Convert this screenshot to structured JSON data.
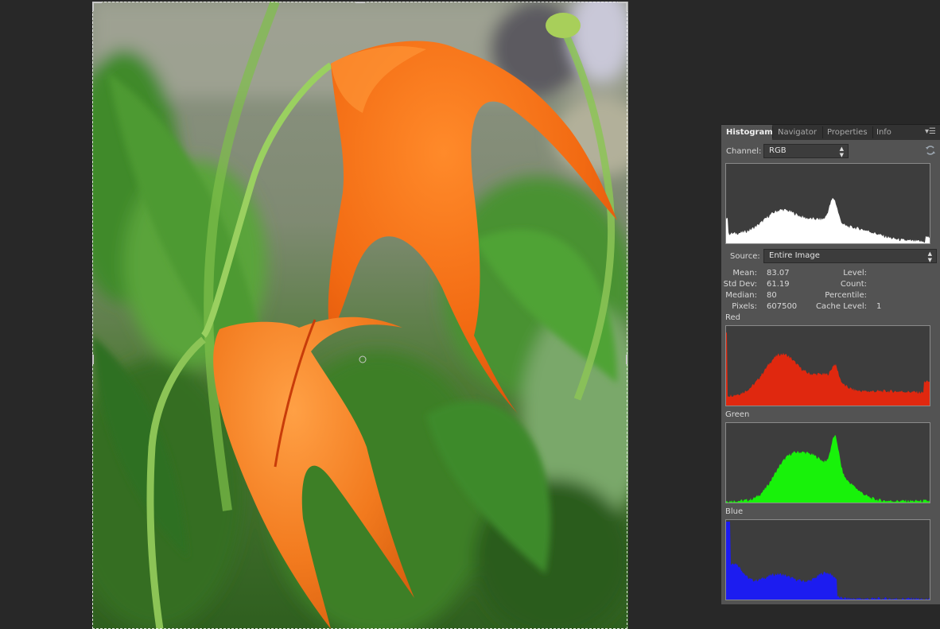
{
  "panel": {
    "tabs": [
      {
        "label": "Histogram",
        "active": true
      },
      {
        "label": "Navigator",
        "active": false
      },
      {
        "label": "Properties",
        "active": false
      },
      {
        "label": "Info",
        "active": false
      }
    ],
    "menu_icon": "panel-menu-icon",
    "channel_label": "Channel:",
    "channel_value": "RGB",
    "refresh_icon": "refresh-icon",
    "source_label": "Source:",
    "source_value": "Entire Image",
    "stats": {
      "mean_label": "Mean:",
      "mean_value": "83.07",
      "stddev_label": "Std Dev:",
      "stddev_value": "61.19",
      "median_label": "Median:",
      "median_value": "80",
      "pixels_label": "Pixels:",
      "pixels_value": "607500",
      "level_label": "Level:",
      "count_label": "Count:",
      "percentile_label": "Percentile:",
      "cache_label": "Cache Level:",
      "cache_value": "1"
    },
    "channels": [
      {
        "name": "Red",
        "color": "#e0280f"
      },
      {
        "name": "Green",
        "color": "#18f20a"
      },
      {
        "name": "Blue",
        "color": "#1c1cf0"
      }
    ],
    "composite_color": "#ffffff"
  },
  "colors": {
    "app_background": "#282828",
    "panel_background": "#535353",
    "histogram_background": "#3d3d3d",
    "petal_orange": "#f26a12",
    "leaf_green": "#3f9a2e"
  }
}
